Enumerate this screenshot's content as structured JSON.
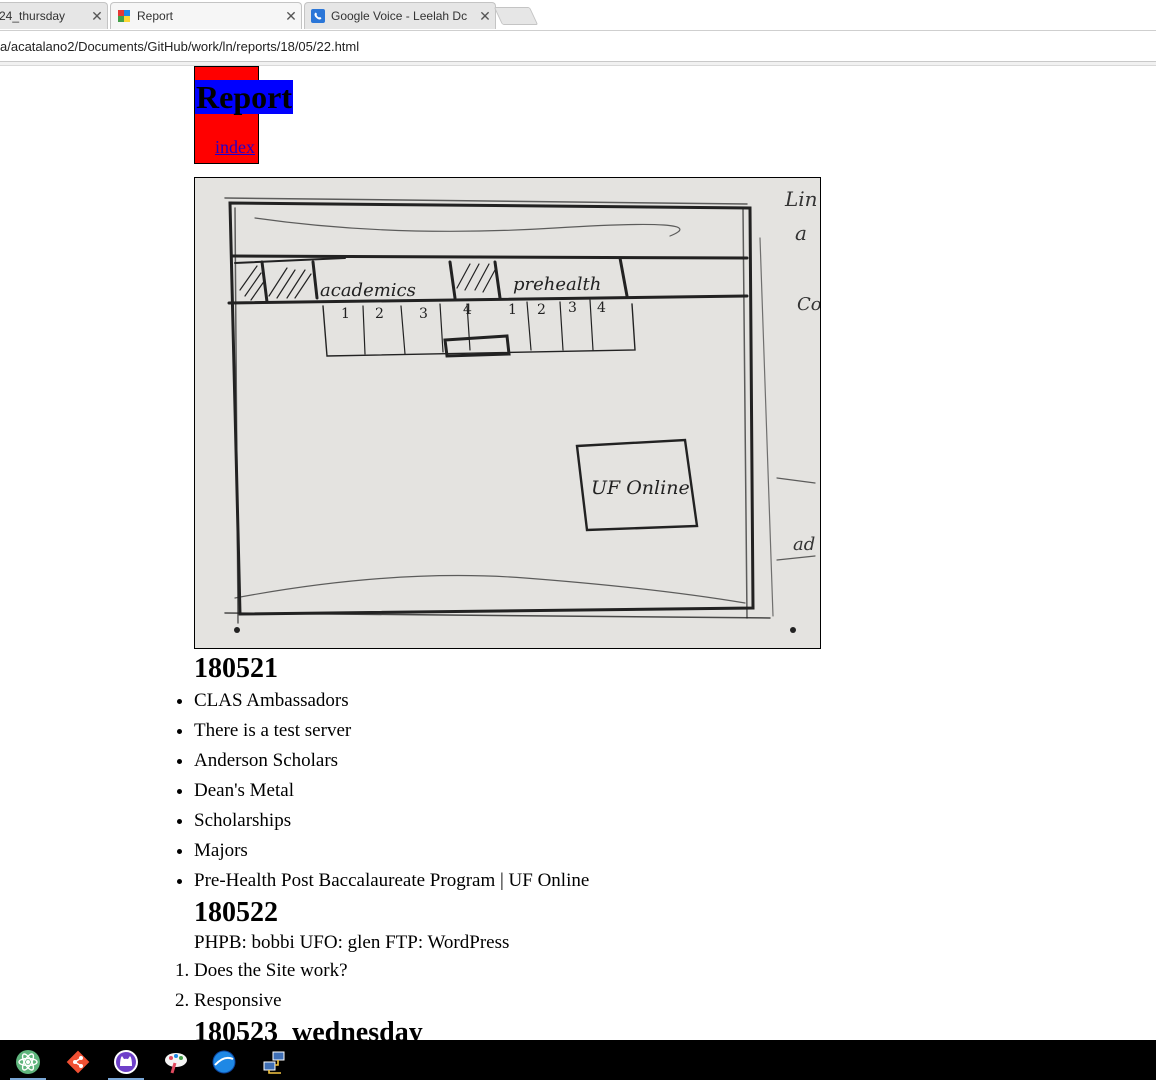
{
  "browser": {
    "tabs": [
      {
        "title": "24_thursday",
        "favicon": "page-icon",
        "active": false
      },
      {
        "title": "Report",
        "favicon": "report-favicon-icon",
        "active": true
      },
      {
        "title": "Google Voice - Leelah Dc",
        "favicon": "google-voice-icon",
        "active": false
      }
    ],
    "close_glyph": "✕",
    "url": "a/acatalano2/Documents/GitHub/work/ln/reports/18/05/22.html"
  },
  "page": {
    "title": "Report",
    "index_link": "index",
    "sketch": {
      "nav_label_1": "academics",
      "nav_label_2": "prehealth",
      "nums_1": [
        "1",
        "2",
        "3",
        "4"
      ],
      "nums_2": [
        "1",
        "2",
        "3",
        "4"
      ],
      "box_label": "UF Online",
      "margin_notes": [
        "Lin",
        "a",
        "Co",
        "ad"
      ]
    },
    "sections": [
      {
        "heading": "180521",
        "bullets": [
          "CLAS Ambassadors",
          "There is a test server",
          "Anderson Scholars",
          "Dean's Metal",
          "Scholarships",
          "Majors",
          "Pre-Health Post Baccalaureate Program | UF Online"
        ]
      },
      {
        "heading": "180522",
        "text": "PHPB: bobbi UFO: glen FTP: WordPress",
        "ordered": [
          "Does the Site work?",
          "Responsive"
        ]
      },
      {
        "heading": "180523_wednesday"
      }
    ]
  },
  "taskbar": {
    "icons": [
      {
        "name": "atom-icon",
        "color": "#5fb57d"
      },
      {
        "name": "git-icon",
        "color": "#f05033"
      },
      {
        "name": "github-desktop-icon",
        "color": "#6e40c9"
      },
      {
        "name": "paint-app-icon",
        "color": "#e04a5f"
      },
      {
        "name": "browser-icon",
        "color": "#1e88e5"
      },
      {
        "name": "network-icon",
        "color": "#3f6fb5"
      }
    ]
  }
}
